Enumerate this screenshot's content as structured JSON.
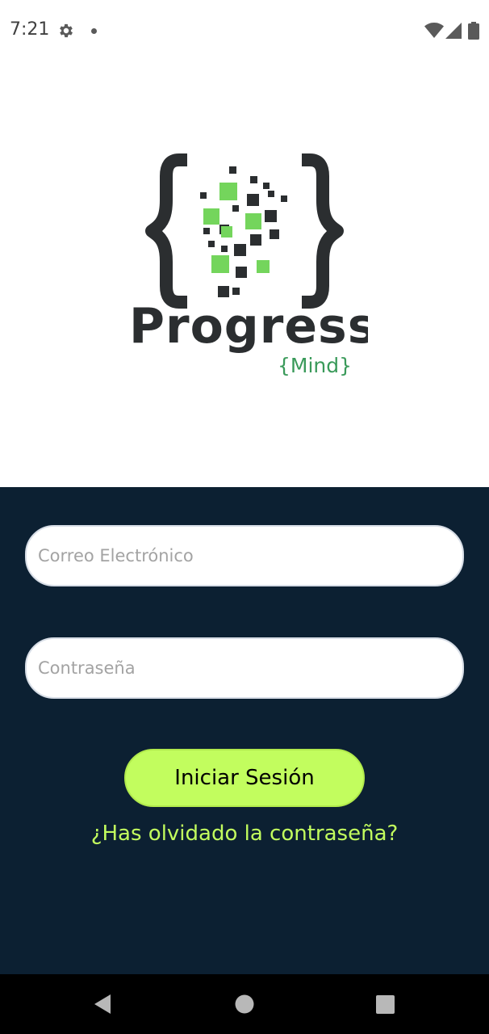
{
  "status_bar": {
    "time": "7:21",
    "icons": [
      "gear-icon",
      "notification-dot-icon",
      "wifi-icon",
      "signal-icon",
      "battery-icon"
    ]
  },
  "logo": {
    "brand": "Progress",
    "sub_brand": "{Mind}",
    "colors": {
      "dark": "#2b2e30",
      "green": "#74d55c",
      "sub_brand": "#3a9a5a"
    }
  },
  "login": {
    "email_placeholder": "Correo Electrónico",
    "email_value": "",
    "password_placeholder": "Contraseña",
    "password_value": "",
    "submit_label": "Iniciar Sesión",
    "forgot_password_label": "¿Has olvidado la contraseña?"
  },
  "nav_bar": {
    "icons": [
      "back-icon",
      "home-icon",
      "recents-icon"
    ]
  },
  "colors": {
    "panel_background": "#0c2032",
    "accent": "#c2fd5e"
  }
}
